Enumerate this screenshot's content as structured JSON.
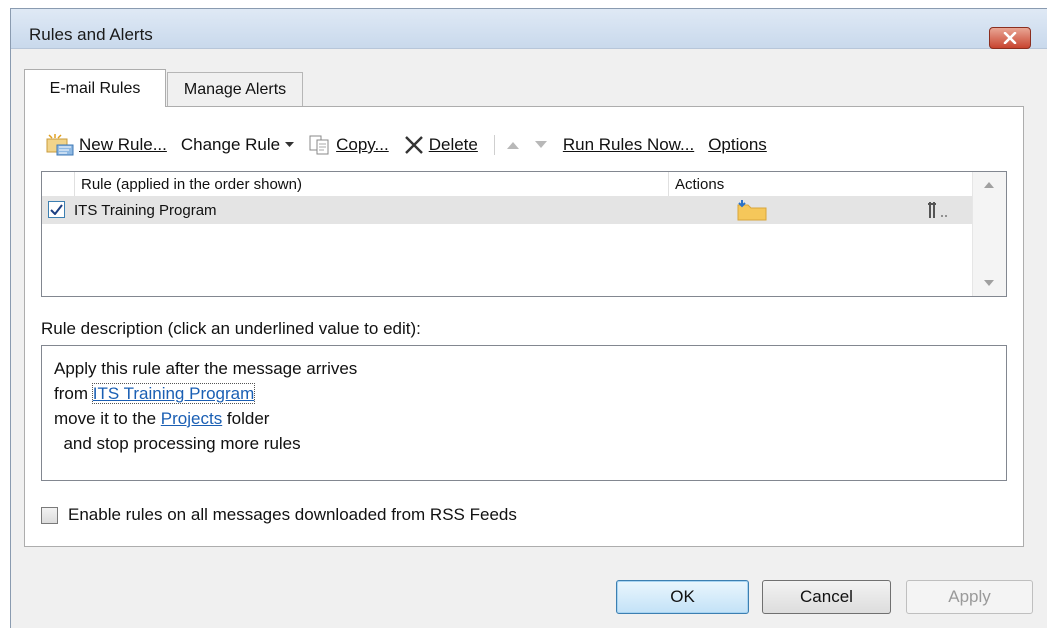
{
  "window": {
    "title": "Rules and Alerts"
  },
  "tabs": [
    {
      "label": "E-mail Rules",
      "active": true
    },
    {
      "label": "Manage Alerts",
      "active": false
    }
  ],
  "toolbar": {
    "new_rule": "New Rule...",
    "change_rule": "Change Rule",
    "copy": "Copy...",
    "delete": "Delete",
    "run_rules_now": "Run Rules Now...",
    "options": "Options"
  },
  "rules_list": {
    "columns": [
      "Rule (applied in the order shown)",
      "Actions"
    ],
    "rows": [
      {
        "name": "ITS Training Program",
        "enabled": true,
        "action_icon": "move-to-folder-icon"
      }
    ]
  },
  "description": {
    "label": "Rule description (click an underlined value to edit):",
    "line1": "Apply this rule after the message arrives",
    "line2_prefix": "from ",
    "line2_link": "ITS Training Program",
    "line3_prefix": "move it to the ",
    "line3_link": "Projects",
    "line3_suffix": " folder",
    "line4": "  and stop processing more rules"
  },
  "rss": {
    "label": "Enable rules on all messages downloaded from RSS Feeds",
    "checked": false
  },
  "buttons": {
    "ok": "OK",
    "cancel": "Cancel",
    "apply": "Apply"
  },
  "colors": {
    "link": "#1a5fb4",
    "ok_border": "#3c7fb1",
    "close_red": "#c8442f"
  }
}
